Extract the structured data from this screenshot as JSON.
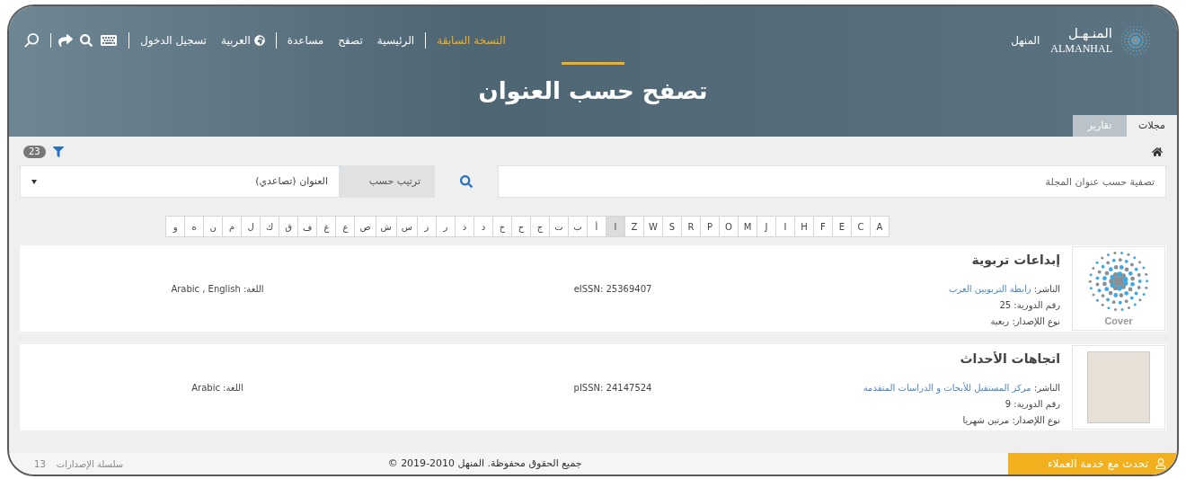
{
  "header": {
    "logo": {
      "arabic": "المنـهـل",
      "latin": "ALMANHAL"
    },
    "site_name": "المنهل",
    "nav_groups": [
      [
        {
          "kind": "link",
          "label": "النسخة السابقة",
          "selected": true
        }
      ],
      [
        {
          "kind": "link",
          "label": "الرئيسية",
          "selected": false
        },
        {
          "kind": "link",
          "label": "تصفح",
          "selected": false
        },
        {
          "kind": "link",
          "label": "مساعدة",
          "selected": false
        }
      ],
      [
        {
          "kind": "language",
          "label": "العربية",
          "selected": false
        },
        {
          "kind": "link",
          "label": "تسجيل الدخول",
          "selected": false
        }
      ]
    ],
    "title": "تصفح حسب العنوان",
    "tabs": [
      {
        "label": "مجلات",
        "selected": true
      },
      {
        "label": "تقارير",
        "selected": false
      }
    ]
  },
  "filter": {
    "result_count": "23",
    "search": {
      "placeholder": "تصفية حسب عنوان المجلة"
    },
    "sort": {
      "label": "ترتيب حسب",
      "value": "العنوان (تصاعدي)"
    }
  },
  "letters": [
    {
      "label": "A",
      "selected": false
    },
    {
      "label": "C",
      "selected": false
    },
    {
      "label": "E",
      "selected": false
    },
    {
      "label": "F",
      "selected": false
    },
    {
      "label": "H",
      "selected": false
    },
    {
      "label": "I",
      "selected": false
    },
    {
      "label": "J",
      "selected": false
    },
    {
      "label": "M",
      "selected": false
    },
    {
      "label": "O",
      "selected": false
    },
    {
      "label": "P",
      "selected": false
    },
    {
      "label": "R",
      "selected": false
    },
    {
      "label": "S",
      "selected": false
    },
    {
      "label": "W",
      "selected": false
    },
    {
      "label": "Z",
      "selected": false
    },
    {
      "label": "ا",
      "selected": true
    },
    {
      "label": "أ",
      "selected": false
    },
    {
      "label": "ب",
      "selected": false
    },
    {
      "label": "ت",
      "selected": false
    },
    {
      "label": "ج",
      "selected": false
    },
    {
      "label": "ح",
      "selected": false
    },
    {
      "label": "خ",
      "selected": false
    },
    {
      "label": "د",
      "selected": false
    },
    {
      "label": "ذ",
      "selected": false
    },
    {
      "label": "ر",
      "selected": false
    },
    {
      "label": "ز",
      "selected": false
    },
    {
      "label": "س",
      "selected": false
    },
    {
      "label": "ش",
      "selected": false
    },
    {
      "label": "ص",
      "selected": false
    },
    {
      "label": "ع",
      "selected": false
    },
    {
      "label": "غ",
      "selected": false
    },
    {
      "label": "ف",
      "selected": false
    },
    {
      "label": "ق",
      "selected": false
    },
    {
      "label": "ك",
      "selected": false
    },
    {
      "label": "ل",
      "selected": false
    },
    {
      "label": "م",
      "selected": false
    },
    {
      "label": "ن",
      "selected": false
    },
    {
      "label": "ه",
      "selected": false
    },
    {
      "label": "و",
      "selected": false
    }
  ],
  "results": [
    {
      "cover": {
        "kind": "placeholder",
        "caption": "Cover"
      },
      "title": "إبداعات تربوية",
      "publisher_label": "الناشر:",
      "publisher": "رابطة التربويين العرب",
      "number_label": "رقم الدورية:",
      "number": "25",
      "type_label": "نوع اللإصدار:",
      "type": "ربعية",
      "issn": "eISSN: 25369407",
      "language_label": "اللغة:",
      "language": "Arabic , English"
    },
    {
      "cover": {
        "kind": "image"
      },
      "title": "اتجاهات الأحداث",
      "publisher_label": "الناشر:",
      "publisher": "مركز المستقبل للأبحاث و الدراسات المتقدمة",
      "number_label": "رقم الدورية:",
      "number": "9",
      "type_label": "نوع اللإصدار:",
      "type": "مرتين شهريا",
      "issn": "pISSN: 24147524",
      "language_label": "اللغة:",
      "language": "Arabic"
    }
  ],
  "footer": {
    "support": "تحدث مع خدمة العملاء",
    "copyright": "جميع الحقوق محفوظة. المنهل 2010-2019 ©",
    "series_label": "سلسلة الإصدارات",
    "series_count": "13"
  }
}
